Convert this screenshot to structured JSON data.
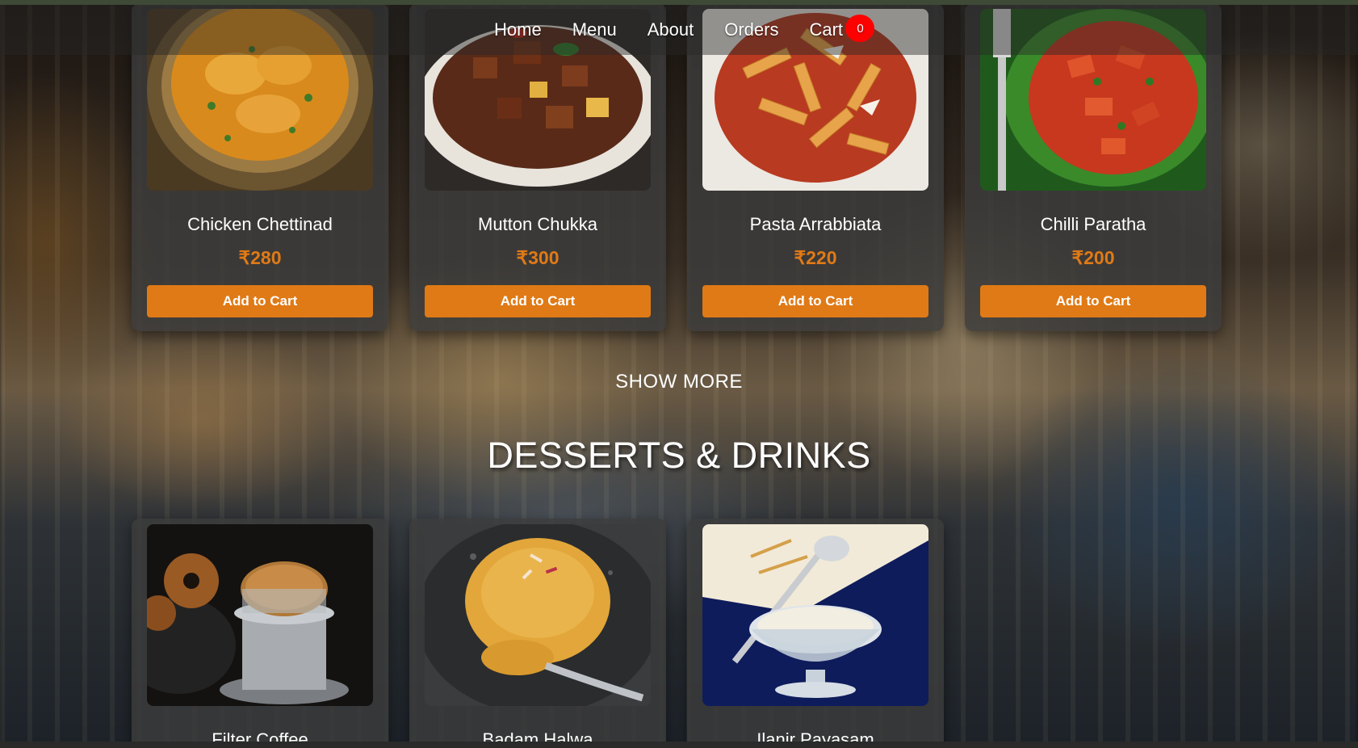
{
  "nav": {
    "items": [
      "Home",
      "Menu",
      "About",
      "Orders"
    ],
    "cart_label": "Cart",
    "cart_count": "0"
  },
  "main_dishes": [
    {
      "name": "Chicken Chettinad",
      "price": "₹280",
      "button": "Add to Cart"
    },
    {
      "name": "Mutton Chukka",
      "price": "₹300",
      "button": "Add to Cart"
    },
    {
      "name": "Pasta Arrabbiata",
      "price": "₹220",
      "button": "Add to Cart"
    },
    {
      "name": "Chilli Paratha",
      "price": "₹200",
      "button": "Add to Cart"
    }
  ],
  "show_more": "SHOW MORE",
  "desserts": {
    "title": "DESSERTS & DRINKS",
    "items": [
      {
        "name": "Filter Coffee"
      },
      {
        "name": "Badam Halwa"
      },
      {
        "name": "Ilanir Payasam"
      }
    ]
  },
  "colors": {
    "accent": "#e07a16",
    "badge": "#ff0000",
    "card_bg": "#3c3c3c"
  }
}
